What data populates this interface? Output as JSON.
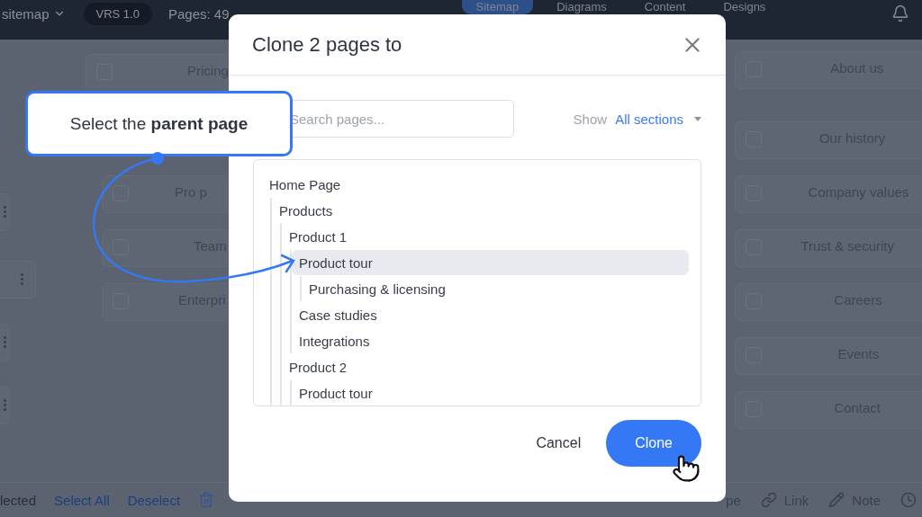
{
  "top_bar": {
    "project": "sitemap",
    "version": "VRS 1.0",
    "pages": "Pages: 49",
    "nav": [
      {
        "label": "Sitemap",
        "selected": true
      },
      {
        "label": "Diagrams",
        "selected": false
      },
      {
        "label": "Content",
        "selected": false
      },
      {
        "label": "Designs",
        "selected": false
      }
    ]
  },
  "canvas": {
    "left_cards": [
      {
        "label": "Pricing",
        "checked": false
      },
      {
        "label": "Pro p",
        "checked": false
      },
      {
        "label": "Team",
        "checked": false
      },
      {
        "label": "Enterpri",
        "checked": false
      }
    ],
    "right_cards": [
      {
        "label": "About us",
        "checked": false
      },
      {
        "label": "Our history",
        "checked": false
      },
      {
        "label": "Company values",
        "checked": false
      },
      {
        "label": "Trust & security",
        "checked": false
      },
      {
        "label": "Careers",
        "checked": false
      },
      {
        "label": "Events",
        "checked": false
      },
      {
        "label": "Contact",
        "checked": false
      }
    ]
  },
  "bottom_bar": {
    "left": [
      {
        "label": "lected",
        "kind": "text"
      },
      {
        "label": "Select All",
        "kind": "link"
      },
      {
        "label": "Deselect",
        "kind": "link"
      }
    ],
    "right": [
      {
        "label": "pe",
        "kind": "text"
      },
      {
        "label": "Link",
        "kind": "link-icon"
      },
      {
        "label": "Note",
        "kind": "pencil"
      }
    ]
  },
  "dialog": {
    "title": "Clone 2 pages to",
    "search": {
      "placeholder": "Search pages..."
    },
    "show_label": "Show",
    "show_value": "All sections",
    "tree": [
      {
        "label": "Home Page",
        "selected": false,
        "children": [
          {
            "label": "Products",
            "selected": false,
            "children": [
              {
                "label": "Product 1",
                "selected": false,
                "children": [
                  {
                    "label": "Product tour",
                    "selected": true,
                    "children": [
                      {
                        "label": "Purchasing & licensing",
                        "selected": false
                      }
                    ]
                  },
                  {
                    "label": "Case studies",
                    "selected": false
                  },
                  {
                    "label": "Integrations",
                    "selected": false
                  }
                ]
              },
              {
                "label": "Product 2",
                "selected": false,
                "children": [
                  {
                    "label": "Product tour",
                    "selected": false
                  }
                ]
              }
            ]
          }
        ]
      }
    ],
    "buttons": [
      {
        "label": "Cancel",
        "kind": "secondary"
      },
      {
        "label": "Clone",
        "kind": "primary"
      }
    ]
  },
  "callout": {
    "text": "Select the **parent page**"
  }
}
